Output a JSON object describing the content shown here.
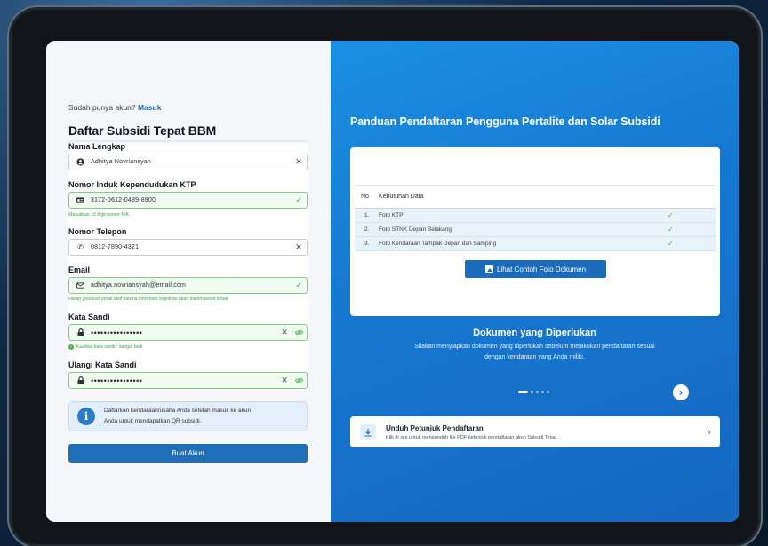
{
  "left": {
    "login_prompt": "Sudah punya akun?",
    "login_link": "Masuk",
    "form_title": "Daftar Subsidi Tepat BBM",
    "fields": {
      "name": {
        "label": "Nama Lengkap",
        "value": "Adhitya Novriansyah"
      },
      "nik": {
        "label": "Nomor Induk Kependudukan KTP",
        "value": "3172-0612-0489-8900",
        "hint": "Masukkan 16 digit nomor NIK"
      },
      "phone": {
        "label": "Nomor Telepon",
        "value": "0812-7890-4321"
      },
      "email": {
        "label": "Email",
        "value": "adhitya.novriansyah@email.com",
        "hint": "Harap gunakan email aktif karena informasi registrasi akan dikirim lewat email."
      },
      "password": {
        "label": "Kata Sandi",
        "value": "••••••••••••••••",
        "hint": "Kualitas kata sandi : sangat baik"
      },
      "confirm": {
        "label": "Ulangi Kata Sandi",
        "value": "••••••••••••••••"
      }
    },
    "info_line1": "Daftarkan kendaraan/usaha Anda setelah masuk ke akun",
    "info_line2": "Anda untuk mendapatkan QR subsidi.",
    "submit_label": "Buat Akun"
  },
  "right": {
    "title": "Panduan Pendaftaran Pengguna Pertalite dan Solar Subsidi",
    "table": {
      "headers": [
        "No",
        "Kebutuhan Data"
      ],
      "rows": [
        {
          "no": "1.",
          "item": "Foto KTP",
          "check": "✓"
        },
        {
          "no": "2.",
          "item": "Foto STNK Depan Belakang",
          "check": "✓"
        },
        {
          "no": "3.",
          "item": "Foto Kendaraan Tampak Depan dan Samping",
          "check": "✓"
        }
      ]
    },
    "example_button": "Lihat Contoh Foto Dokumen",
    "doc_title": "Dokumen yang Diperlukan",
    "doc_desc_1": "Silakan menyiapkan dokumen yang diperlukan sebelum melakukan pendaftaran sesuai",
    "doc_desc_2": "dengan kendaraan yang Anda miliki.",
    "carousel": {
      "slides": 5,
      "active": 1
    },
    "download": {
      "title": "Unduh Petunjuk Pendaftaran",
      "desc": "Klik di sini untuk mengunduh file PDF petunjuk pendaftaran akun Subsidi Tepat."
    }
  },
  "colors": {
    "accent": "#1f6fb8",
    "panel_blue": "#1677cf",
    "success": "#3fb84a"
  },
  "icons": [
    "user-circle-icon",
    "id-card-icon",
    "phone-icon",
    "mail-icon",
    "lock-icon",
    "clear-icon",
    "check-icon",
    "eye-off-icon",
    "info-icon",
    "image-icon",
    "download-icon",
    "chevron-right-icon"
  ]
}
